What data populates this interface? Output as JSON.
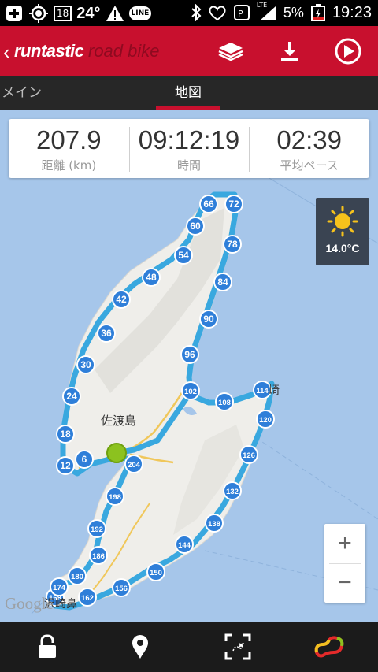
{
  "statusbar": {
    "badge": "18",
    "temperature": "24°",
    "line_label": "LINE",
    "network": "LTE",
    "battery": "5%",
    "time": "19:23"
  },
  "appbar": {
    "brand": "runtastic",
    "product": "road bike",
    "icons": [
      "layers-icon",
      "download-icon",
      "play-store-icon"
    ]
  },
  "tabs": [
    {
      "label": "メイン",
      "active": false
    },
    {
      "label": "地図",
      "active": true
    }
  ],
  "stats": [
    {
      "value": "207.9",
      "label": "距離 (km)"
    },
    {
      "value": "09:12:19",
      "label": "時間"
    },
    {
      "value": "02:39",
      "label": "平均ペース"
    }
  ],
  "weather": {
    "temperature": "14.0°C",
    "icon": "sun-icon"
  },
  "map": {
    "island_label": "佐渡島",
    "place_kisaki": "崎",
    "place_south": "沢崎鼻",
    "watermark": "Google",
    "km_markers": [
      "6",
      "12",
      "18",
      "24",
      "30",
      "36",
      "42",
      "48",
      "54",
      "60",
      "66",
      "72",
      "78",
      "84",
      "90",
      "96",
      "102",
      "108",
      "114",
      "120",
      "126",
      "132",
      "138",
      "144",
      "150",
      "156",
      "162",
      "168",
      "174",
      "180",
      "186",
      "192",
      "198",
      "204"
    ],
    "zoom_in": "+",
    "zoom_out": "−"
  },
  "bottombar": {
    "icons": [
      "lock-icon",
      "location-pin-icon",
      "fit-route-icon",
      "route-overview-icon"
    ]
  },
  "colors": {
    "brand_red": "#c8102e",
    "route": "#39a8df",
    "marker": "#2f7fd9",
    "sea": "#a6c6ea",
    "land": "#efeeea",
    "start": "#8cc21f"
  }
}
